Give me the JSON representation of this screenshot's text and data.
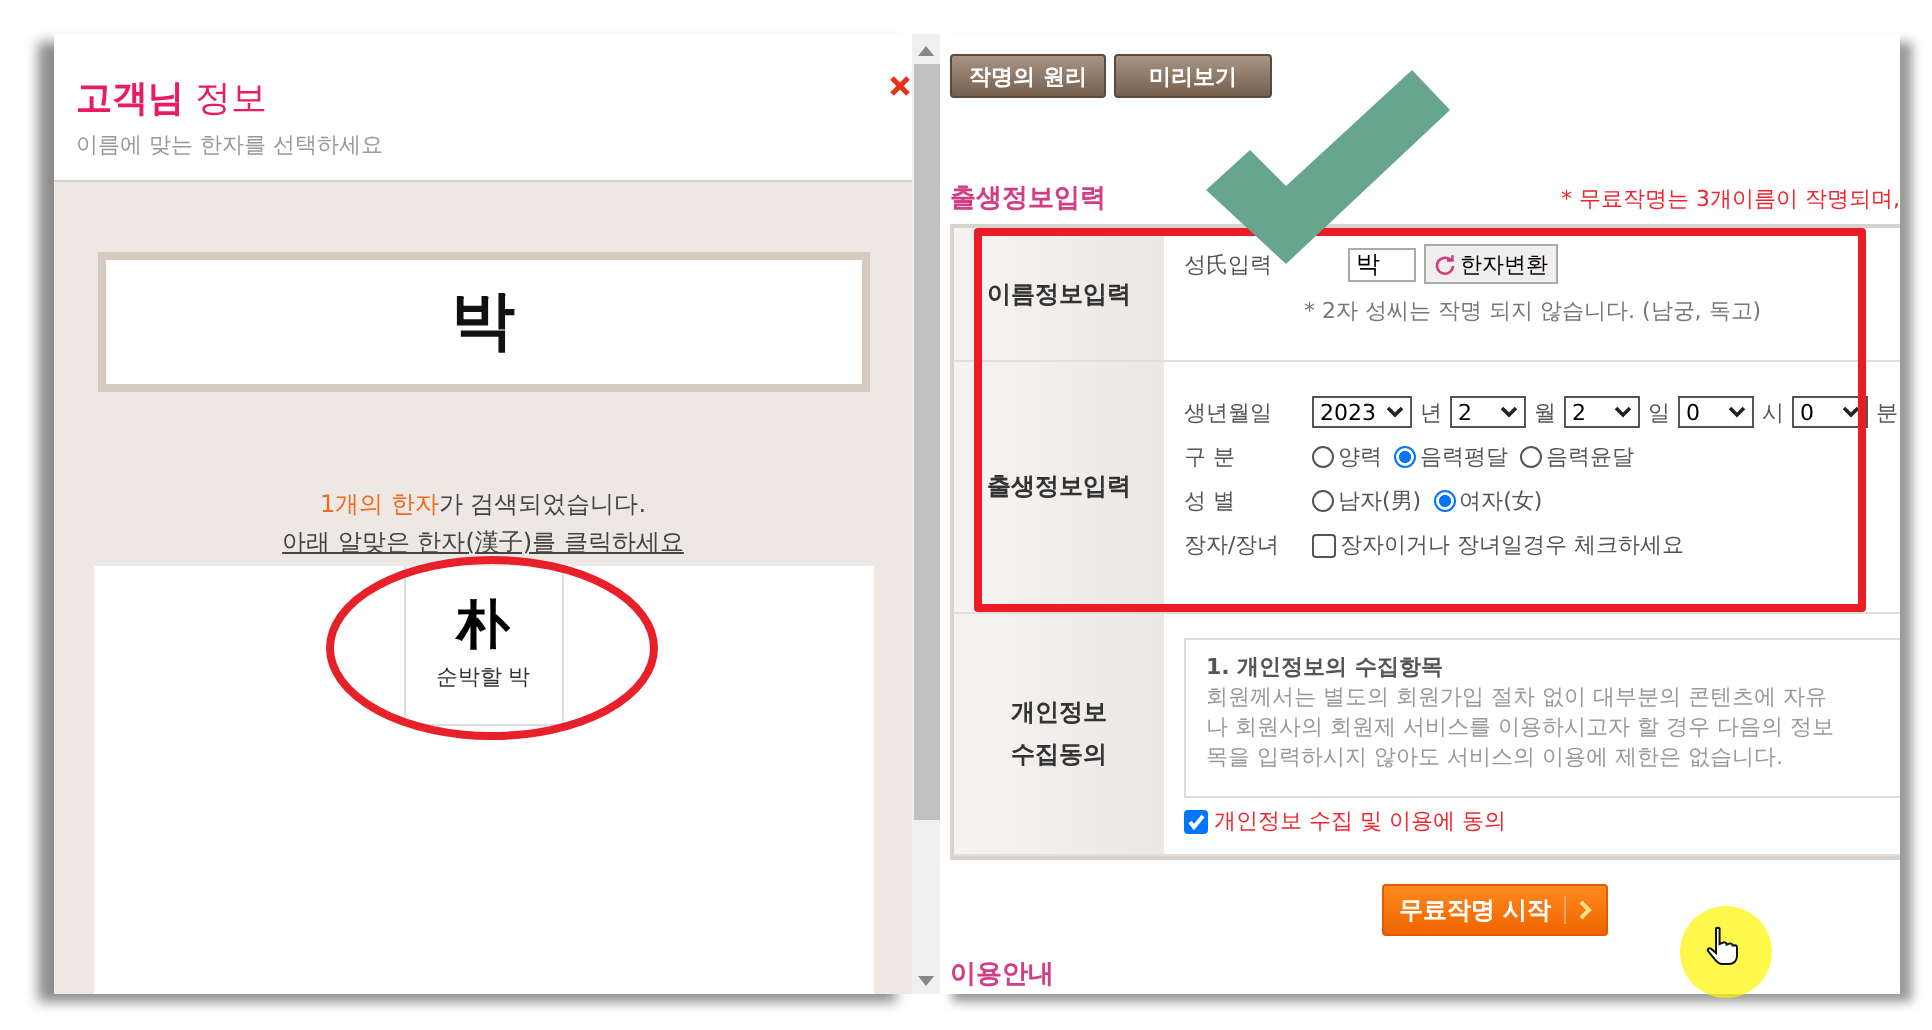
{
  "dialog": {
    "title": "**고객님** 정보",
    "subtitle": "이름에 맞는 한자를 선택하세요",
    "surname": "박",
    "found_highlight": "1개의 한자",
    "found_rest": "가 검색되었습니다.",
    "instruction": "아래 알맞은 한자(漢子)를 클릭하세요",
    "hanja": [
      {
        "character": "朴",
        "meaning": "순박할 박"
      }
    ]
  },
  "toolbar": {
    "buttons": [
      "작명의 원리",
      "미리보기"
    ]
  },
  "section": {
    "title": "출생정보입력",
    "note": "* 무료작명는 3개이름이 작명되며,"
  },
  "name_row": {
    "header": "이름정보입력",
    "label": "성氏입력",
    "value": "박",
    "convert_button": "한자변환",
    "note": "* 2자 성씨는 작명 되지 않습니다. (남궁, 독고)"
  },
  "birth_row": {
    "header": "출생정보입력",
    "date_label": "생년월일",
    "date_fields": [
      {
        "value": "2023",
        "unit": "년"
      },
      {
        "value": "2",
        "unit": "월"
      },
      {
        "value": "2",
        "unit": "일"
      },
      {
        "value": "0",
        "unit": "시"
      },
      {
        "value": "0",
        "unit": "분"
      }
    ],
    "options": [
      {
        "label": "구 분",
        "kind": "radio",
        "choices": [
          {
            "label": "양력",
            "selected": false
          },
          {
            "label": "음력평달",
            "selected": true
          },
          {
            "label": "음력윤달",
            "selected": false
          }
        ]
      },
      {
        "label": "성 별",
        "kind": "radio",
        "choices": [
          {
            "label": "남자(男)",
            "selected": false
          },
          {
            "label": "여자(女)",
            "selected": true
          }
        ]
      },
      {
        "label": "장자/장녀",
        "kind": "checkbox",
        "text": "장자이거나 장녀일경우 체크하세요",
        "checked": false
      }
    ]
  },
  "consent_row": {
    "header_lines": [
      "개인정보",
      "수집동의"
    ],
    "heading": "1. 개인정보의 수집항목",
    "lines": [
      "회원께서는 별도의 회원가입 절차 없이 대부분의 콘텐츠에 자유",
      "나 회원사의 회원제 서비스를 이용하시고자 할 경우 다음의 정보",
      "목을 입력하시지 않아도 서비스의 이용에 제한은 없습니다."
    ],
    "agree_label": "개인정보 수집 및 이용에 동의",
    "agreed": true
  },
  "start_button": "무료작명 시작",
  "footer_title": "이용안내"
}
